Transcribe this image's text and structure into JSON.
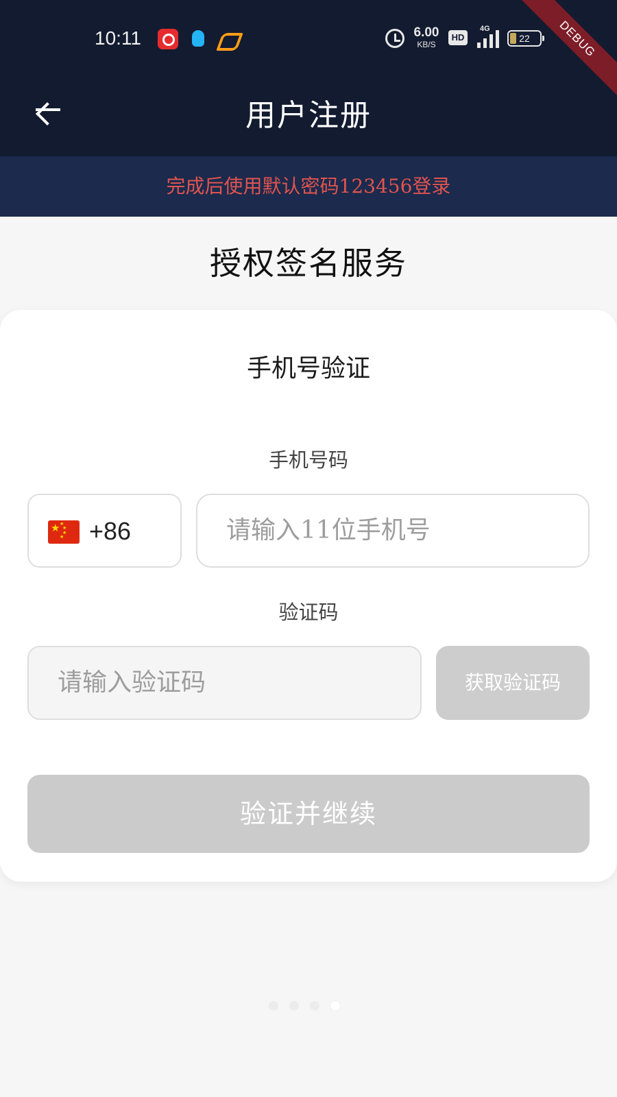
{
  "status_bar": {
    "time": "10:11",
    "net_speed_value": "6.00",
    "net_speed_unit": "KB/S",
    "hd_label": "HD",
    "network_type": "4G",
    "battery_level": "22",
    "battery_fraction": 0.22,
    "app_icons": [
      "netease-music-icon",
      "qq-icon",
      "heart-app-icon"
    ]
  },
  "debug_banner": "DEBUG",
  "header": {
    "title": "用户注册",
    "back_icon": "arrow-left-icon"
  },
  "notice": {
    "text": "完成后使用默认密码123456登录",
    "color": "#e0544f"
  },
  "service_title": "授权签名服务",
  "card": {
    "title": "手机号验证",
    "phone_label": "手机号码",
    "country_flag": "china-flag-icon",
    "country_code": "+86",
    "phone_placeholder": "请输入11位手机号",
    "code_label": "验证码",
    "code_placeholder": "请输入验证码",
    "get_code_button": "获取验证码",
    "submit_button": "验证并继续"
  },
  "pager": {
    "count": 4,
    "active_index": 3
  },
  "colors": {
    "header_bg": "#131b30",
    "notice_bg": "#1b2a4d",
    "disabled_button": "#cdcdcd",
    "debug_ribbon": "#7d1d28"
  }
}
